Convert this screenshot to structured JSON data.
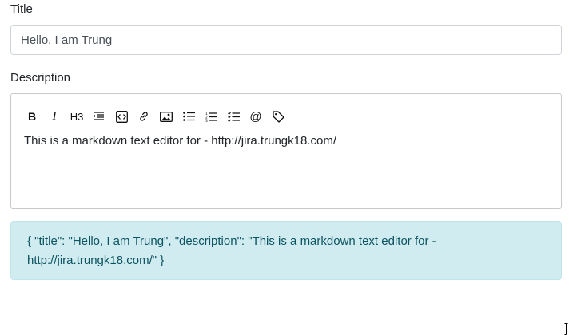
{
  "form": {
    "title_label": "Title",
    "title_value": "Hello, I am Trung",
    "description_label": "Description"
  },
  "editor": {
    "toolbar": {
      "bold_label": "B",
      "italic_label": "I",
      "heading_label": "H3",
      "icons": [
        "bold-icon",
        "italic-icon",
        "heading-icon",
        "quote-icon",
        "code-icon",
        "link-icon",
        "image-icon",
        "bullet-list-icon",
        "numbered-list-icon",
        "task-list-icon",
        "mention-icon",
        "tag-icon"
      ],
      "mention_label": "@"
    },
    "content": "This is a markdown text editor for - http://jira.trungk18.com/"
  },
  "output": {
    "json_text": "{ \"title\": \"Hello, I am Trung\", \"description\": \"This is a markdown text editor for - http://jira.trungk18.com/\" }",
    "accent_color": "#d1ecf1",
    "text_color": "#0c5460"
  }
}
